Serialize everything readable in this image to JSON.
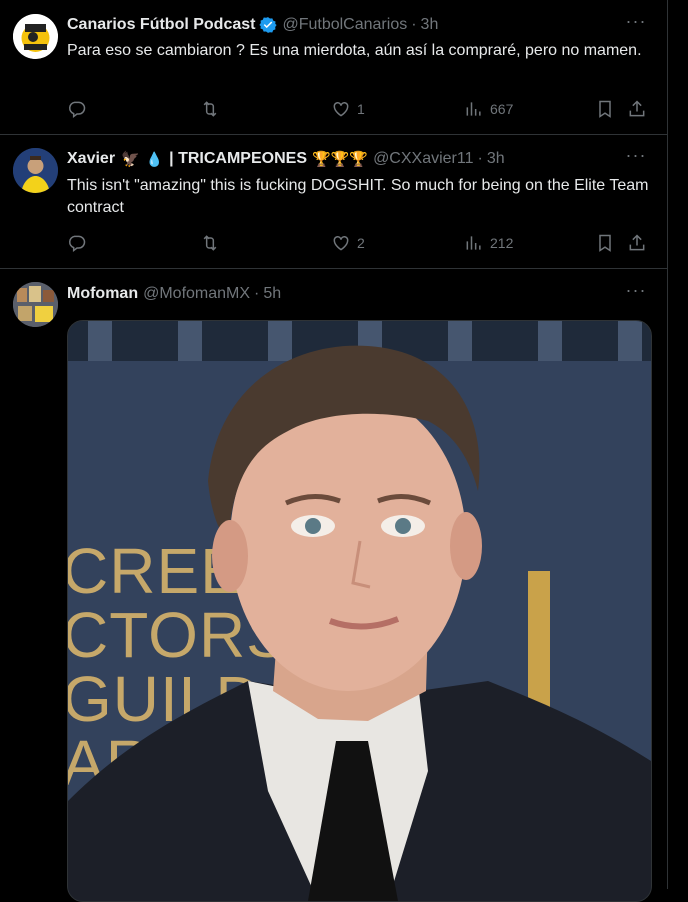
{
  "tweets": [
    {
      "name": "Canarios Fútbol Podcast",
      "handle": "@FutbolCanarios",
      "dot": "·",
      "time": "3h",
      "text": "Para eso se cambiaron ? Es una mierdota, aún así la compraré, pero no mamen.",
      "replies": "",
      "retweets": "",
      "likes": "1",
      "views": "667",
      "verified": true
    },
    {
      "name": "Xavier",
      "name_suffix": "| TRICAMPEONES",
      "handle": "@CXXavier11",
      "dot": "·",
      "time": "3h",
      "text": "This isn't \"amazing\" this is fucking DOGSHIT. So much for being on the Elite Team contract",
      "replies": "",
      "retweets": "",
      "likes": "2",
      "views": "212",
      "emojis": [
        "eagle-icon",
        "blood-drop-icon",
        "trophy-icon",
        "trophy-icon",
        "trophy-icon"
      ]
    },
    {
      "name": "Mofoman",
      "handle": "@MofomanMX",
      "dot": "·",
      "time": "5h",
      "media_text": "CREE CTORS GUILD AWARD"
    }
  ],
  "colors": {
    "verified": "#1d9bf0",
    "muted": "#71767b",
    "border": "#2f3336"
  }
}
